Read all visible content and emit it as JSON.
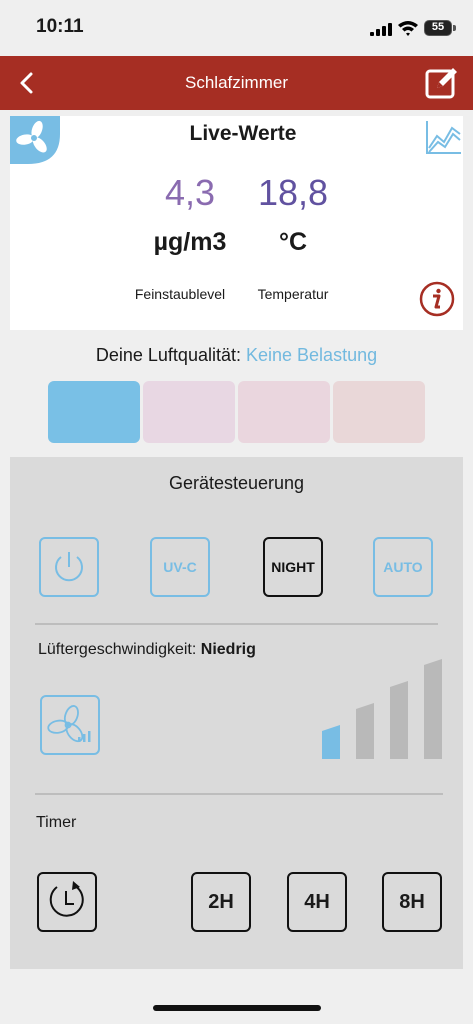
{
  "status_bar": {
    "time": "10:11",
    "battery": "55"
  },
  "nav": {
    "title": "Schlafzimmer",
    "back_icon": "chevron-left-icon",
    "edit_icon": "edit-icon"
  },
  "live": {
    "title": "Live-Werte",
    "pm_value": "4,3",
    "pm_unit": "µg/m3",
    "pm_label": "Feinstaublevel",
    "temp_value": "18,8",
    "temp_unit": "°C",
    "temp_label": "Temperatur",
    "badge_icon": "fan-icon",
    "chart_icon": "line-chart-icon",
    "info_icon": "info-icon"
  },
  "air_quality": {
    "label": "Deine Luftqualität:",
    "status": "Keine Belastung",
    "segments": [
      {
        "color": "#79c0e6",
        "active": true
      },
      {
        "color": "#e8d7e3",
        "active": false
      },
      {
        "color": "#ead6de",
        "active": false
      },
      {
        "color": "#e9d7d8",
        "active": false
      }
    ]
  },
  "controls": {
    "title": "Gerätesteuerung",
    "buttons": [
      {
        "label": "",
        "icon": "power-icon",
        "active": false
      },
      {
        "label": "UV-C",
        "active": false
      },
      {
        "label": "NIGHT",
        "active": true
      },
      {
        "label": "AUTO",
        "active": false
      }
    ],
    "fan_speed_label": "Lüftergeschwindigkeit:",
    "fan_speed_value": "Niedrig",
    "fan_speed_level": 1,
    "fan_speed_levels": 4,
    "timer_label": "Timer",
    "timer_options": [
      "2H",
      "4H",
      "8H"
    ],
    "colors": {
      "accent": "#78bde4",
      "brand": "#a62e23"
    }
  }
}
